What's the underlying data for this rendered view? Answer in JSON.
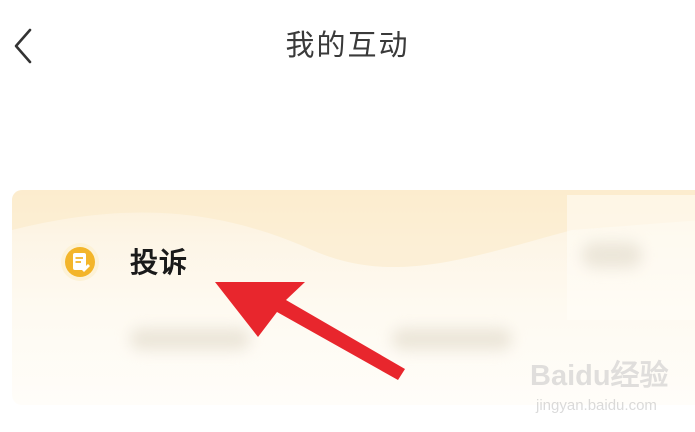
{
  "header": {
    "title": "我的互动",
    "back_icon": "chevron-left-icon"
  },
  "card": {
    "items": [
      {
        "label": "投诉",
        "icon": "document-edit-icon",
        "icon_color": "#f3b52a"
      }
    ]
  },
  "annotation": {
    "arrow_color": "#e8262d"
  },
  "watermark": {
    "logo": "Baidu经验",
    "url": "jingyan.baidu.com"
  }
}
